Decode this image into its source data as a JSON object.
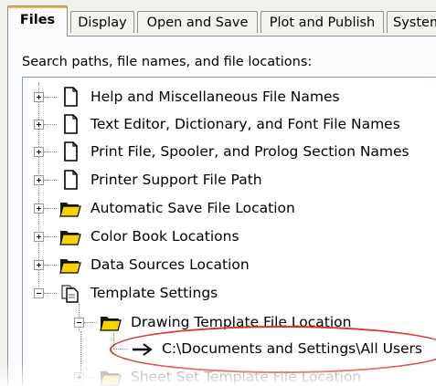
{
  "tabs": [
    {
      "label": "Files",
      "active": true
    },
    {
      "label": "Display",
      "active": false
    },
    {
      "label": "Open and Save",
      "active": false
    },
    {
      "label": "Plot and Publish",
      "active": false
    },
    {
      "label": "System",
      "active": false
    }
  ],
  "caption": "Search paths, file names, and file locations:",
  "tree": [
    {
      "label": "Help and Miscellaneous File Names",
      "icon": "document-icon",
      "expanded": false
    },
    {
      "label": "Text Editor, Dictionary, and Font File Names",
      "icon": "document-icon",
      "expanded": false
    },
    {
      "label": "Print File, Spooler, and Prolog Section Names",
      "icon": "document-icon",
      "expanded": false
    },
    {
      "label": "Printer Support File Path",
      "icon": "document-icon",
      "expanded": false
    },
    {
      "label": "Automatic Save File Location",
      "icon": "folder-icon",
      "expanded": false
    },
    {
      "label": "Color Book Locations",
      "icon": "folder-icon",
      "expanded": false
    },
    {
      "label": "Data Sources Location",
      "icon": "folder-icon",
      "expanded": false
    },
    {
      "label": "Template Settings",
      "icon": "documents-icon",
      "expanded": true
    },
    {
      "label": "Drawing Template File Location",
      "icon": "folder-icon",
      "expanded": true
    },
    {
      "label": "C:\\Documents and Settings\\All Users",
      "icon": "arrow-icon"
    },
    {
      "label": "Sheet Set Template File Location",
      "icon": "folder-icon",
      "expanded": false
    }
  ],
  "colors": {
    "highlight_ellipse": "#d9342b",
    "active_tab_accent": "#f2b63e",
    "folder": "#f5d300"
  }
}
